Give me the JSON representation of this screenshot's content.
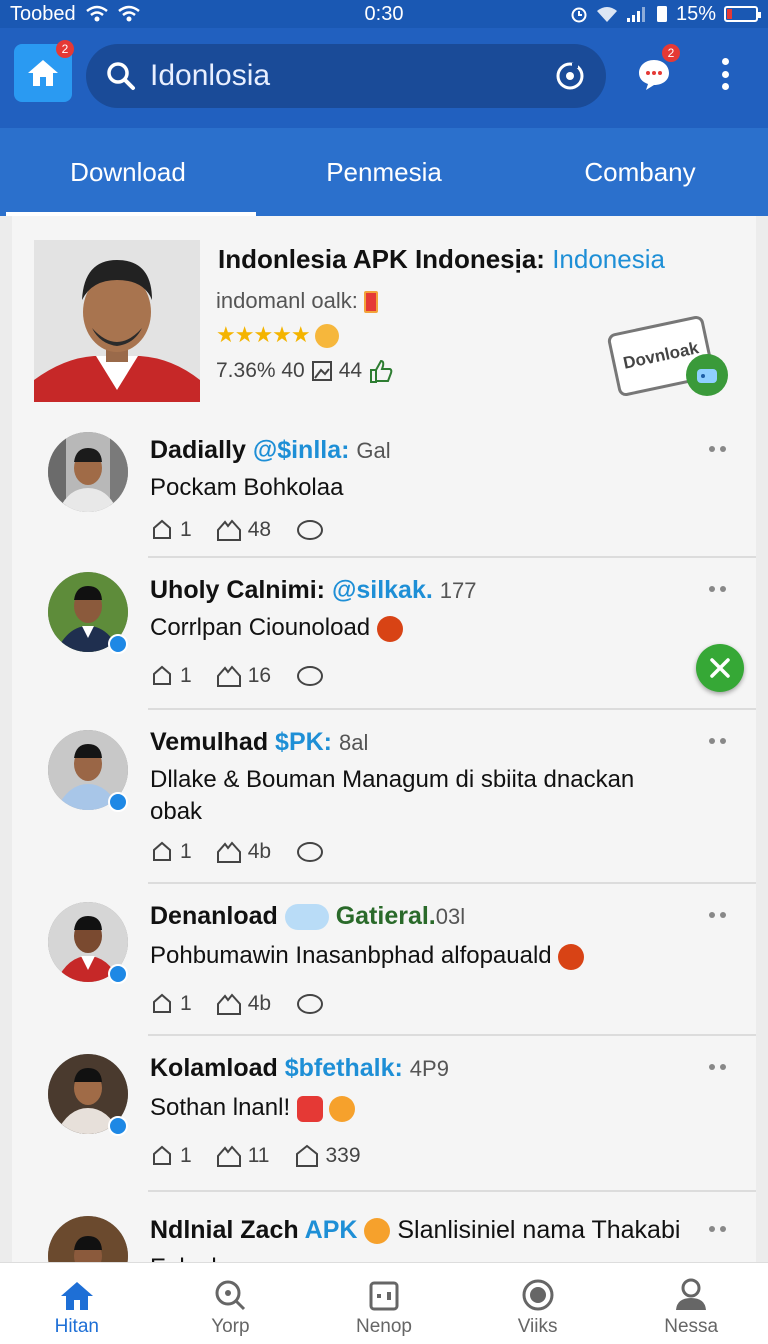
{
  "status": {
    "carrier": "Toobed",
    "time": "0:30",
    "battery": "15%"
  },
  "header": {
    "home_badge": "2",
    "search_query": "Idonlosia",
    "chat_badge": "2"
  },
  "tabs": [
    {
      "label": "Download",
      "active": true
    },
    {
      "label": "Penmesia",
      "active": false
    },
    {
      "label": "Combany",
      "active": false
    }
  ],
  "featured": {
    "title": "Indonlesia APK Indonesịa:",
    "title_highlight": "Indonesia",
    "subtitle": "indomanl oalk:",
    "stars": "★★★★★",
    "stat1": "7.36% 40",
    "stat2": "44",
    "stamp": "Dovnloak"
  },
  "posts": [
    {
      "name": "Dadially",
      "tag": "@$inlla:",
      "meta": "Gal",
      "body": "Pockam Bohkolaa",
      "likes": "1",
      "shares": "48"
    },
    {
      "name": "Uholy Calnimi:",
      "tag": "@silkak.",
      "meta": "177",
      "body": "Corrlpan Ciounoload",
      "likes": "1",
      "shares": "16"
    },
    {
      "name": "Vemulhad",
      "tag": "$PK:",
      "meta": "8al",
      "body": "Dllake & Bouman Managum di sbiita dnackan obak",
      "likes": "1",
      "shares": "4b"
    },
    {
      "name": "Denanload",
      "tag": "Gatieral.",
      "meta": "03l",
      "body": "Pohbumawin Inasanbphad alfopauald",
      "likes": "1",
      "shares": "4b"
    },
    {
      "name": "Kolamload",
      "tag": "$bfethalk:",
      "meta": "4P9",
      "body": "Sothan lnanl!",
      "likes": "1",
      "shares": "11",
      "extra": "339"
    },
    {
      "name": "Ndlnial Zach",
      "tag": "APK",
      "meta": "Slanlisiniel nama Thakabi",
      "body": "Enlaply"
    }
  ],
  "bottom_nav": [
    {
      "label": "Hitan",
      "active": true
    },
    {
      "label": "Yorp",
      "active": false
    },
    {
      "label": "Nenop",
      "active": false
    },
    {
      "label": "Viiks",
      "active": false
    },
    {
      "label": "Nessa",
      "active": false
    }
  ],
  "colors": {
    "primary": "#2160bf",
    "accent": "#1e8fd6",
    "success": "#36a836",
    "badge": "#e53935"
  }
}
